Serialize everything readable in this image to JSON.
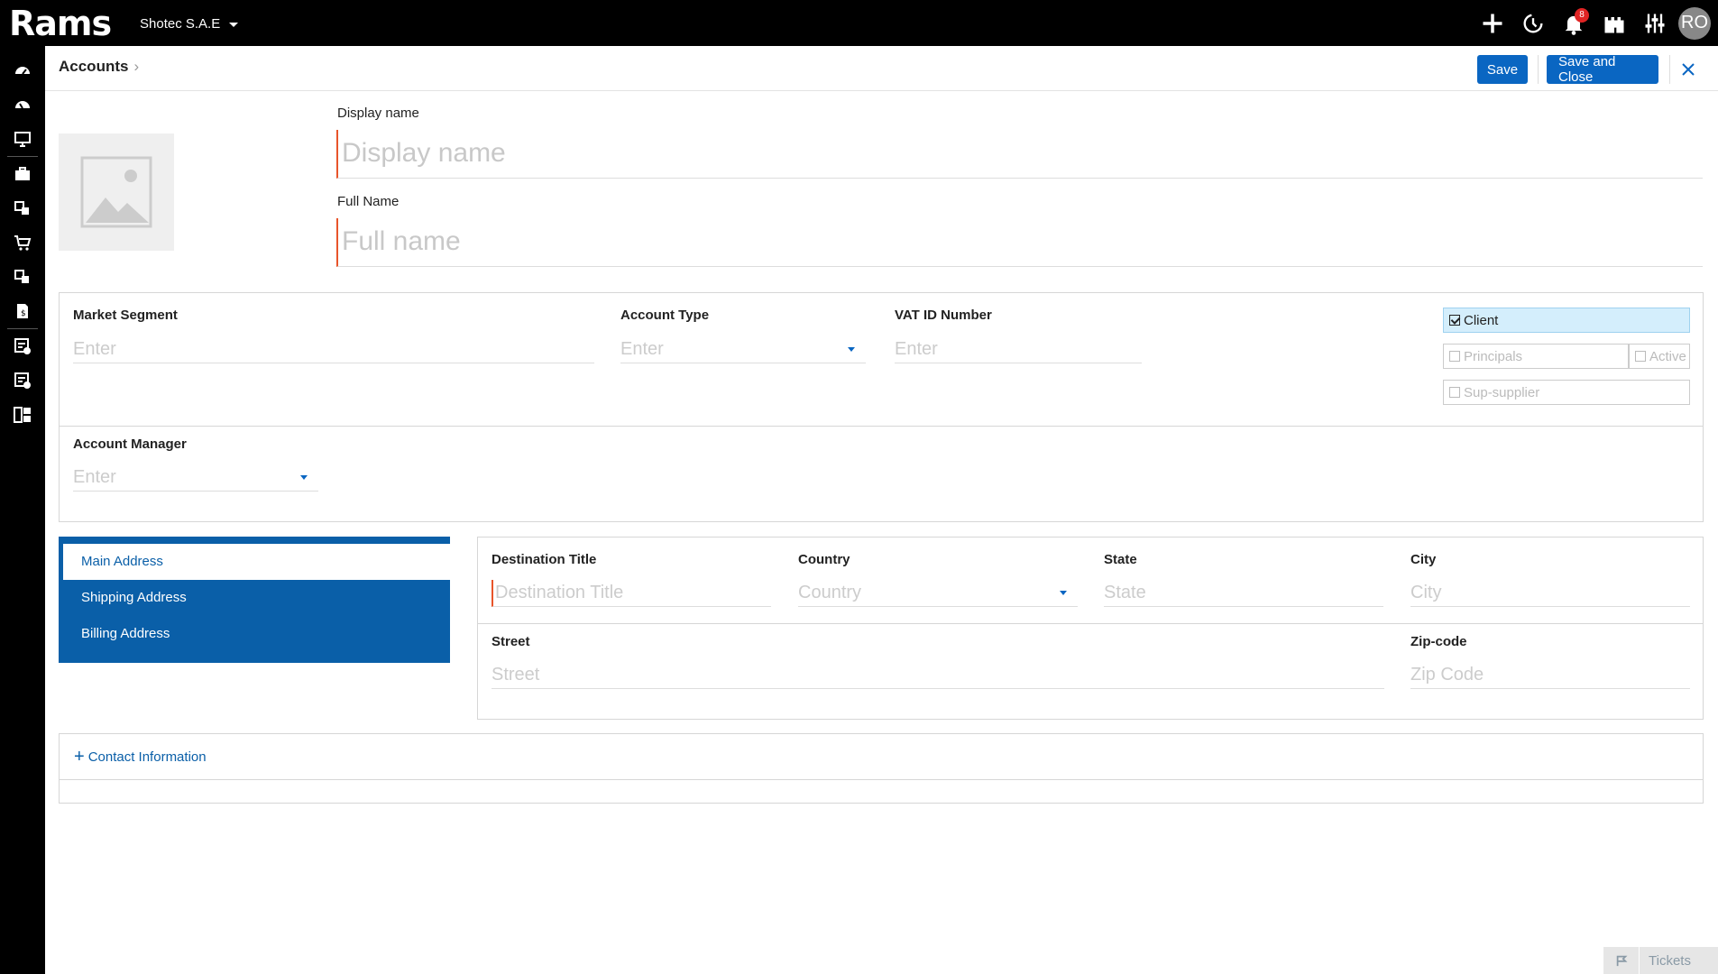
{
  "app": {
    "logo_text": "Rams",
    "company": "Shotec S.A.E"
  },
  "topbar": {
    "notifications_count": "8",
    "avatar_initials": "RO",
    "icons": [
      "plus-icon",
      "history-icon",
      "bell-icon",
      "castle-icon",
      "sliders-icon"
    ]
  },
  "sidebar": {
    "icons": [
      "dashboard-icon",
      "dashboard-alt-icon",
      "monitor-icon",
      "briefcase-icon",
      "modules-icon",
      "cart-icon",
      "modules-alt-icon",
      "invoice-icon",
      "checklist-icon",
      "settings-doc-icon",
      "grid-icon"
    ]
  },
  "header": {
    "breadcrumb": "Accounts",
    "breadcrumb_chevron": "›",
    "save_label": "Save",
    "save_close_label": "Save and Close"
  },
  "form": {
    "display_name": {
      "label": "Display name",
      "placeholder": "Display name"
    },
    "full_name": {
      "label": "Full Name",
      "placeholder": "Full name"
    },
    "market_segment": {
      "label": "Market Segment",
      "placeholder": "Enter"
    },
    "account_type": {
      "label": "Account Type",
      "placeholder": "Enter"
    },
    "vat_id": {
      "label": "VAT ID Number",
      "placeholder": "Enter"
    },
    "account_manager": {
      "label": "Account Manager",
      "placeholder": "Enter"
    },
    "flags": {
      "client": {
        "label": "Client",
        "checked": true
      },
      "principals": {
        "label": "Principals",
        "checked": false
      },
      "active": {
        "label": "Active",
        "checked": false
      },
      "sup_supplier": {
        "label": "Sup-supplier",
        "checked": false
      }
    }
  },
  "address": {
    "tabs": [
      "Main Address",
      "Shipping Address",
      "Billing Address"
    ],
    "active_tab": "Main Address",
    "destination_title": {
      "label": "Destination Title",
      "placeholder": "Destination Title"
    },
    "country": {
      "label": "Country",
      "placeholder": "Country"
    },
    "state": {
      "label": "State",
      "placeholder": "State"
    },
    "city": {
      "label": "City",
      "placeholder": "City"
    },
    "street": {
      "label": "Street",
      "placeholder": "Street"
    },
    "zip": {
      "label": "Zip-code",
      "placeholder": "Zip Code"
    }
  },
  "contact": {
    "plus": "+",
    "label": "Contact Information"
  },
  "tickets": {
    "label": "Tickets"
  },
  "colors": {
    "primary": "#0a66c2",
    "tab_bg": "#0a5fa8",
    "required": "#e8542a",
    "topbar": "#000000"
  }
}
